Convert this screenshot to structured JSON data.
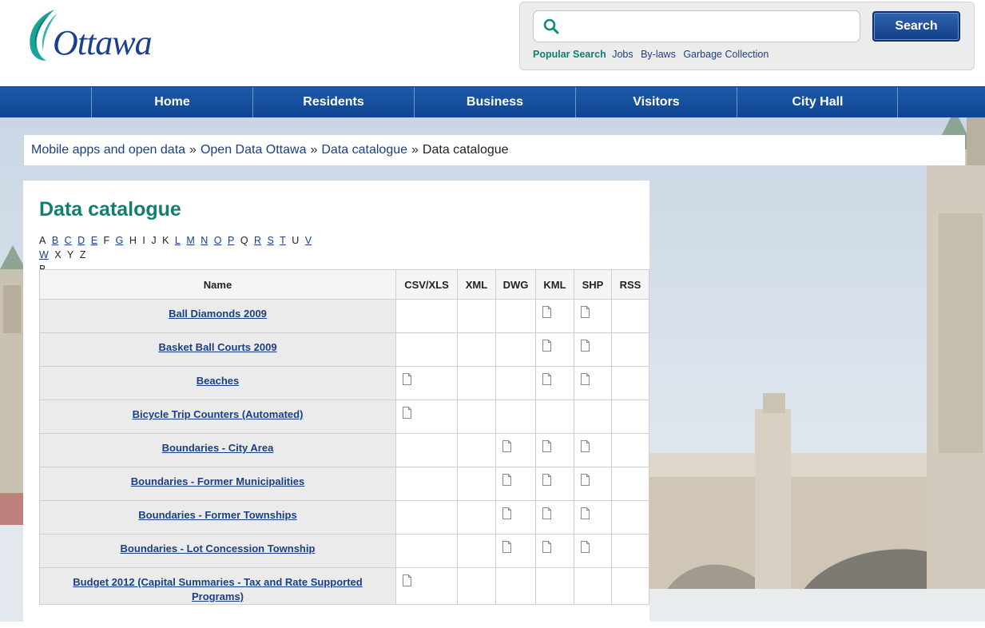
{
  "header": {
    "logo_text": "Ottawa",
    "search": {
      "placeholder": "",
      "button_label": "Search"
    },
    "popular": {
      "label": "Popular Search",
      "links": [
        "Jobs",
        "By-laws",
        "Garbage Collection"
      ]
    }
  },
  "nav": {
    "items": [
      "Home",
      "Residents",
      "Business",
      "Visitors",
      "City Hall"
    ]
  },
  "breadcrumb": {
    "items": [
      "Mobile apps and open data",
      "Open Data Ottawa",
      "Data catalogue"
    ],
    "current": "Data catalogue",
    "separator": "»"
  },
  "page": {
    "title": "Data catalogue",
    "alphabet": [
      {
        "letter": "A",
        "link": false
      },
      {
        "letter": "B",
        "link": true
      },
      {
        "letter": "C",
        "link": true
      },
      {
        "letter": "D",
        "link": true
      },
      {
        "letter": "E",
        "link": true
      },
      {
        "letter": "F",
        "link": false
      },
      {
        "letter": "G",
        "link": true
      },
      {
        "letter": "H",
        "link": false
      },
      {
        "letter": "I",
        "link": false
      },
      {
        "letter": "J",
        "link": false
      },
      {
        "letter": "K",
        "link": false
      },
      {
        "letter": "L",
        "link": true
      },
      {
        "letter": "M",
        "link": true
      },
      {
        "letter": "N",
        "link": true
      },
      {
        "letter": "O",
        "link": true
      },
      {
        "letter": "P",
        "link": true
      },
      {
        "letter": "Q",
        "link": false
      },
      {
        "letter": "R",
        "link": true
      },
      {
        "letter": "S",
        "link": true
      },
      {
        "letter": "T",
        "link": true
      },
      {
        "letter": "U",
        "link": false
      },
      {
        "letter": "V",
        "link": true
      },
      {
        "letter": "W",
        "link": true
      },
      {
        "letter": "X",
        "link": false
      },
      {
        "letter": "Y",
        "link": false
      },
      {
        "letter": "Z",
        "link": false
      }
    ],
    "current_letter": "B"
  },
  "table": {
    "columns": [
      "Name",
      "CSV/XLS",
      "XML",
      "DWG",
      "KML",
      "SHP",
      "RSS"
    ],
    "rows": [
      {
        "name": "Ball Diamonds 2009",
        "formats": [
          false,
          false,
          false,
          true,
          true,
          false
        ]
      },
      {
        "name": "Basket Ball Courts 2009",
        "formats": [
          false,
          false,
          false,
          true,
          true,
          false
        ]
      },
      {
        "name": "Beaches",
        "formats": [
          true,
          false,
          false,
          true,
          true,
          false
        ]
      },
      {
        "name": "Bicycle Trip Counters (Automated)",
        "formats": [
          true,
          false,
          false,
          false,
          false,
          false
        ]
      },
      {
        "name": "Boundaries - City Area",
        "formats": [
          false,
          false,
          true,
          true,
          true,
          false
        ]
      },
      {
        "name": "Boundaries - Former Municipalities",
        "formats": [
          false,
          false,
          true,
          true,
          true,
          false
        ]
      },
      {
        "name": "Boundaries - Former Townships",
        "formats": [
          false,
          false,
          true,
          true,
          true,
          false
        ]
      },
      {
        "name": "Boundaries - Lot Concession Township",
        "formats": [
          false,
          false,
          true,
          true,
          true,
          false
        ]
      },
      {
        "name": "Budget 2012 (Capital Summaries - Tax and Rate Supported Programs)",
        "formats": [
          true,
          false,
          false,
          false,
          false,
          false
        ]
      }
    ]
  },
  "colors": {
    "brand_blue": "#1a4f9c",
    "title_teal": "#0e7f72",
    "link_blue": "#1a3f86"
  }
}
